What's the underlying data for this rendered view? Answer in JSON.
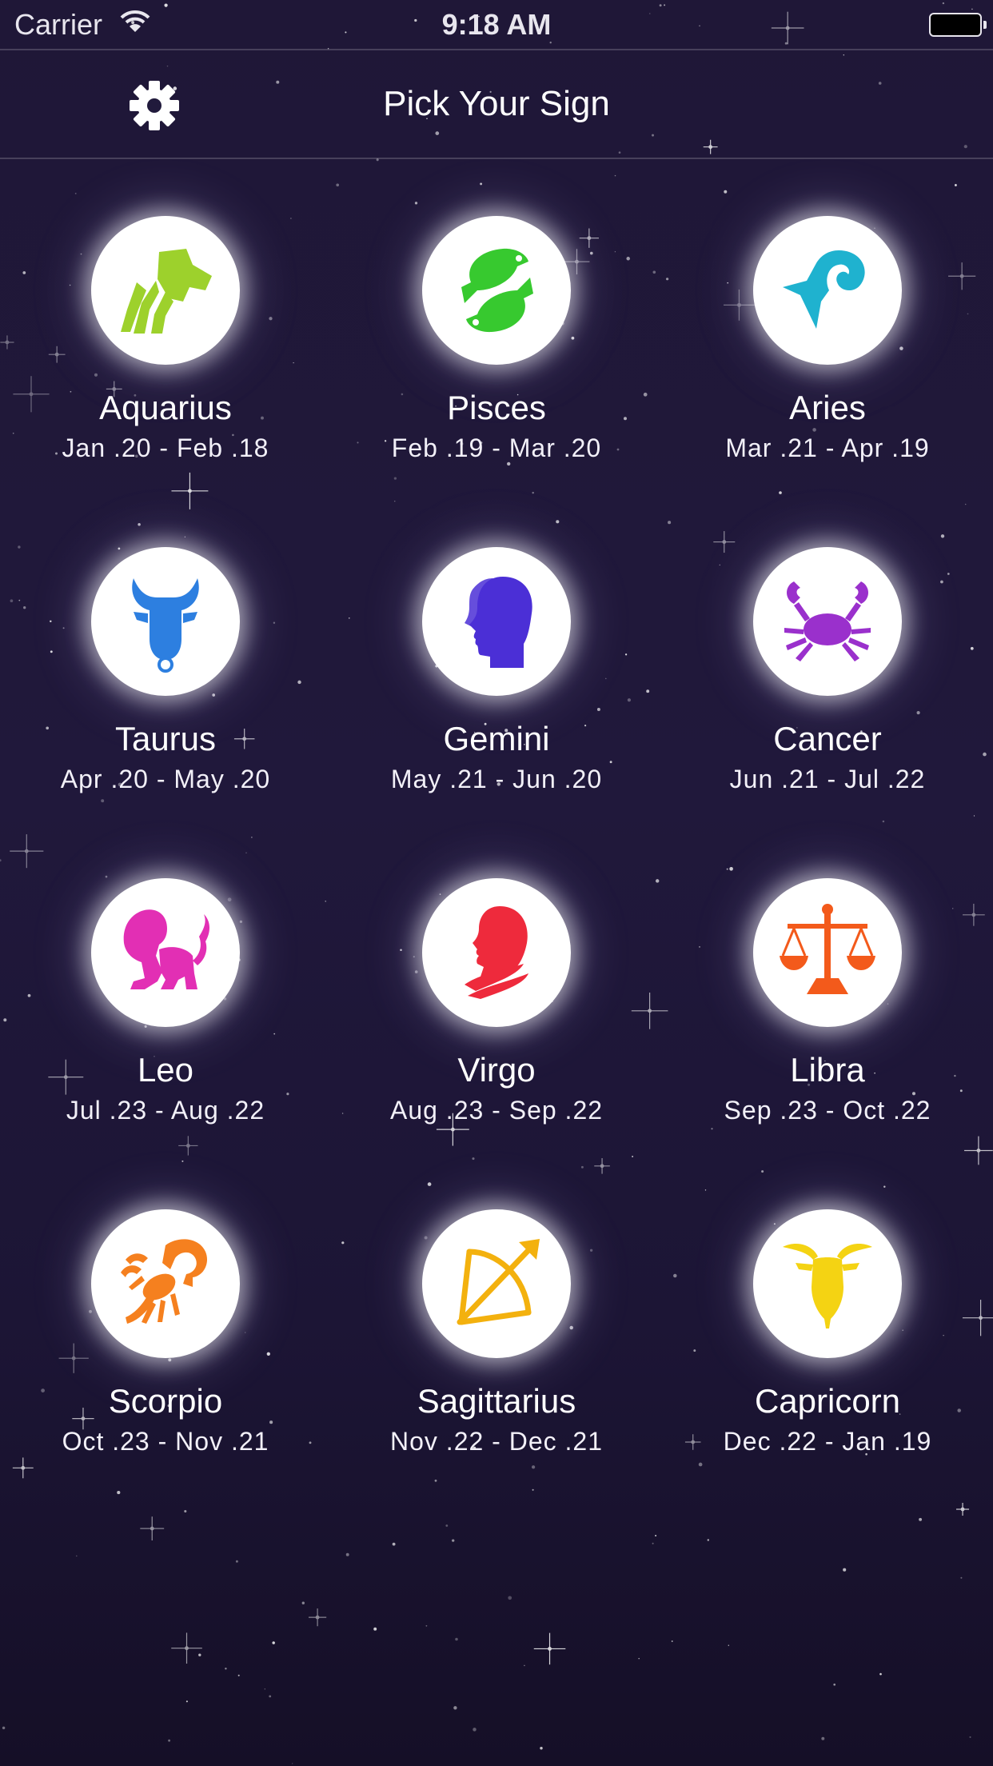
{
  "status_bar": {
    "carrier": "Carrier",
    "time": "9:18 AM"
  },
  "nav": {
    "title": "Pick Your Sign",
    "settings_icon": "gear-icon"
  },
  "signs": [
    {
      "name": "Aquarius",
      "dates": "Jan .20 - Feb .18",
      "icon": "aquarius-icon",
      "color": "#9dd12c"
    },
    {
      "name": "Pisces",
      "dates": "Feb .19 - Mar .20",
      "icon": "pisces-icon",
      "color": "#37c92f"
    },
    {
      "name": "Aries",
      "dates": "Mar .21 - Apr .19",
      "icon": "aries-icon",
      "color": "#1fb2cf"
    },
    {
      "name": "Taurus",
      "dates": "Apr .20 - May .20",
      "icon": "taurus-icon",
      "color": "#2d7fe0"
    },
    {
      "name": "Gemini",
      "dates": "May .21 - Jun .20",
      "icon": "gemini-icon",
      "color": "#4b2fd6"
    },
    {
      "name": "Cancer",
      "dates": "Jun .21 - Jul .22",
      "icon": "cancer-icon",
      "color": "#9a30cc"
    },
    {
      "name": "Leo",
      "dates": "Jul .23 - Aug .22",
      "icon": "leo-icon",
      "color": "#e22fb4"
    },
    {
      "name": "Virgo",
      "dates": "Aug .23 - Sep .22",
      "icon": "virgo-icon",
      "color": "#ee2a3c"
    },
    {
      "name": "Libra",
      "dates": "Sep .23 - Oct .22",
      "icon": "libra-icon",
      "color": "#f35a1b"
    },
    {
      "name": "Scorpio",
      "dates": "Oct .23 - Nov .21",
      "icon": "scorpio-icon",
      "color": "#f5801f"
    },
    {
      "name": "Sagittarius",
      "dates": "Nov .22 - Dec .21",
      "icon": "sagittarius-icon",
      "color": "#f3b10e"
    },
    {
      "name": "Capricorn",
      "dates": "Dec .22 - Jan .19",
      "icon": "capricorn-icon",
      "color": "#f4d313"
    }
  ]
}
